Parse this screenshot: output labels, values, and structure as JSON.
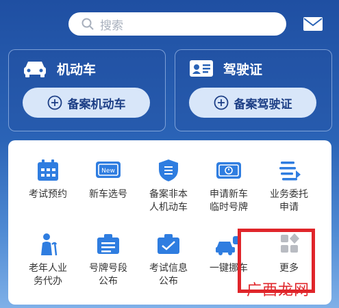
{
  "search": {
    "placeholder": "搜索"
  },
  "cards": {
    "vehicle": {
      "title": "机动车",
      "button": "备案机动车"
    },
    "license": {
      "title": "驾驶证",
      "button": "备案驾驶证"
    }
  },
  "grid": {
    "items": [
      {
        "label": "考试预约",
        "icon": "calendar-icon"
      },
      {
        "label": "新车选号",
        "icon": "new-plate-icon"
      },
      {
        "label": "备案非本人机动车",
        "icon": "shield-record-icon"
      },
      {
        "label": "申请新车临时号牌",
        "icon": "temp-plate-icon"
      },
      {
        "label": "业务委托申请",
        "icon": "delegate-list-icon"
      },
      {
        "label": "老年人业务代办",
        "icon": "elderly-icon"
      },
      {
        "label": "号牌号段公布",
        "icon": "plate-segment-icon"
      },
      {
        "label": "考试信息公布",
        "icon": "exam-info-icon"
      },
      {
        "label": "一键挪车",
        "icon": "move-car-icon"
      },
      {
        "label": "更多",
        "icon": "more-grid-icon"
      }
    ]
  },
  "watermark": "广西龙网",
  "colors": {
    "brand_blue": "#2a63b6",
    "icon_blue": "#2f7de0",
    "highlight": "#e0252a"
  }
}
